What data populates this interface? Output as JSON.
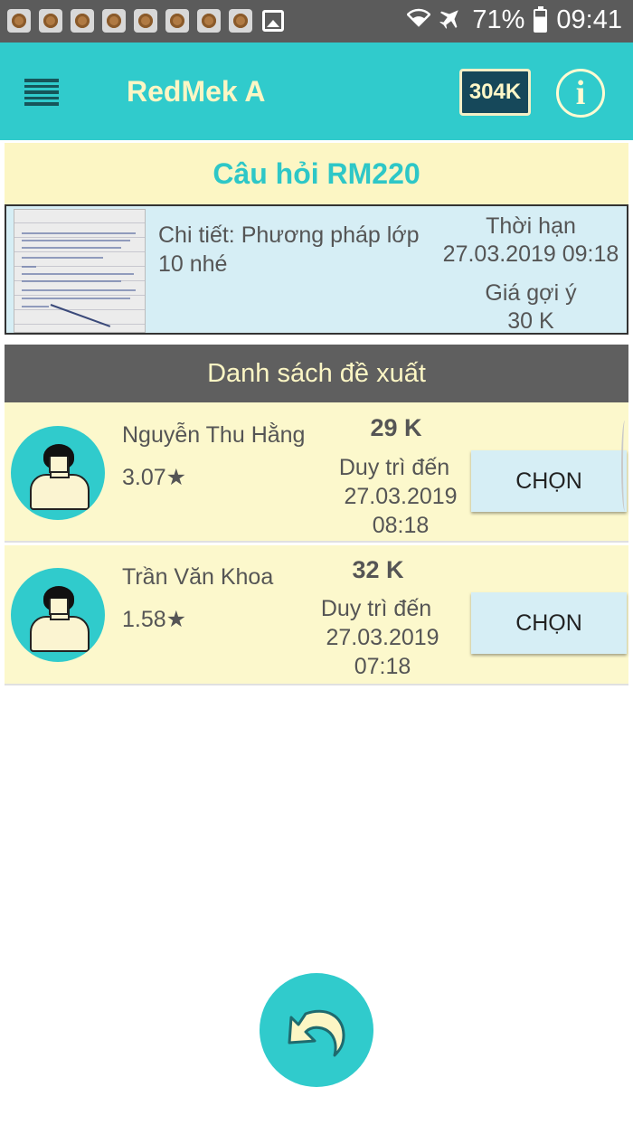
{
  "status_bar": {
    "notification_icons": [
      "app-notification-icon",
      "app-notification-icon",
      "app-notification-icon",
      "app-notification-icon",
      "app-notification-icon",
      "app-notification-icon",
      "app-notification-icon",
      "app-notification-icon"
    ],
    "battery_percent": "71%",
    "time": "09:41"
  },
  "app_bar": {
    "title": "RedMek A",
    "balance": "304K",
    "info_glyph": "i",
    "menu_icon": "hamburger-menu-icon"
  },
  "question": {
    "title": "Câu hỏi RM220",
    "detail": "Chi tiết: Phương pháp lớp 10 nhé",
    "deadline_label": "Thời hạn",
    "deadline_value": "27.03.2019 09:18",
    "price_label": "Giá gợi ý",
    "price_value": "30 K"
  },
  "offers": {
    "title": "Danh sách đề xuất",
    "items": [
      {
        "name": "Nguyễn Thu Hằng",
        "rating": "3.07★",
        "price": "29 K",
        "duration_label": "Duy trì đến",
        "duration_date": "27.03.2019",
        "duration_time": "08:18",
        "button_label": "CHỌN"
      },
      {
        "name": "Trần Văn Khoa",
        "rating": "1.58★",
        "price": "32 K",
        "duration_label": "Duy trì đến",
        "duration_date": "27.03.2019",
        "duration_time": "07:18",
        "button_label": "CHỌN"
      }
    ]
  },
  "colors": {
    "accent": "#30cbcc",
    "header_text": "#fcf6c4",
    "offer_bg": "#fcf8cc",
    "card_bg": "#d6eef5",
    "list_header": "#5f5f5f",
    "badge_bg": "#16485a"
  },
  "back_button_icon": "undo-arrow-icon"
}
